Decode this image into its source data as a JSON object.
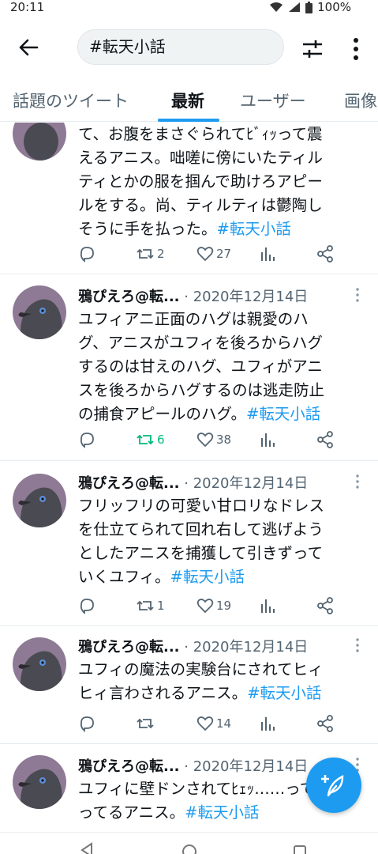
{
  "status": {
    "time": "20:11",
    "battery": "100%"
  },
  "search": {
    "query": "#転天小話"
  },
  "tabs": [
    "話題のツイート",
    "最新",
    "ユーザー",
    "画像"
  ],
  "tweets": [
    {
      "name": "",
      "date": "",
      "lines": [
        "て、お腹をまさぐられてﾋﾞｨｯって震",
        "えるアニス。咄嗟に傍にいたティル",
        "ティとかの服を掴んで助けろアピー",
        "ルをする。尚、ティルティは鬱陶し"
      ],
      "last_line": "そうに手を払った。",
      "hashtag": "#転天小話",
      "retweets": "2",
      "likes": "27"
    },
    {
      "name": "鴉ぴえろ@転...",
      "date": "· 2020年12月14日",
      "lines": [
        "ユフィアニ正面のハグは親愛のハ",
        "グ、アニスがユフィを後ろからハグ",
        "するのは甘えのハグ、ユフィがアニ",
        "スを後ろからハグするのは逃走防止"
      ],
      "last_line": "の捕食アピールのハグ。",
      "hashtag": "#転天小話",
      "retweets": "6",
      "likes": "38"
    },
    {
      "name": "鴉ぴえろ@転...",
      "date": "· 2020年12月14日",
      "lines": [
        "フリッフリの可愛い甘ロリなドレス",
        "を仕立てられて回れ右して逃げよう",
        "としたアニスを捕獲して引きずって"
      ],
      "last_line": "いくユフィ。",
      "hashtag": "#転天小話",
      "retweets": "1",
      "likes": "19"
    },
    {
      "name": "鴉ぴえろ@転...",
      "date": "· 2020年12月14日",
      "lines": [
        "ユフィの魔法の実験台にされてヒィ"
      ],
      "last_line": "ヒィ言わされるアニス。",
      "hashtag": "#転天小話",
      "retweets": "",
      "likes": "14"
    },
    {
      "name": "鴉ぴえろ@転...",
      "date": "· 2020年12月14日",
      "lines": [
        "ユフィに壁ドンされてﾋｪｯ……ってな"
      ],
      "last_line": "ってるアニス。",
      "hashtag": "#転天小話",
      "retweets": "",
      "likes": ""
    }
  ],
  "colors": {
    "accent": "#1d9bf0",
    "retweet_active": "#00ba7c",
    "muted": "#536471"
  }
}
